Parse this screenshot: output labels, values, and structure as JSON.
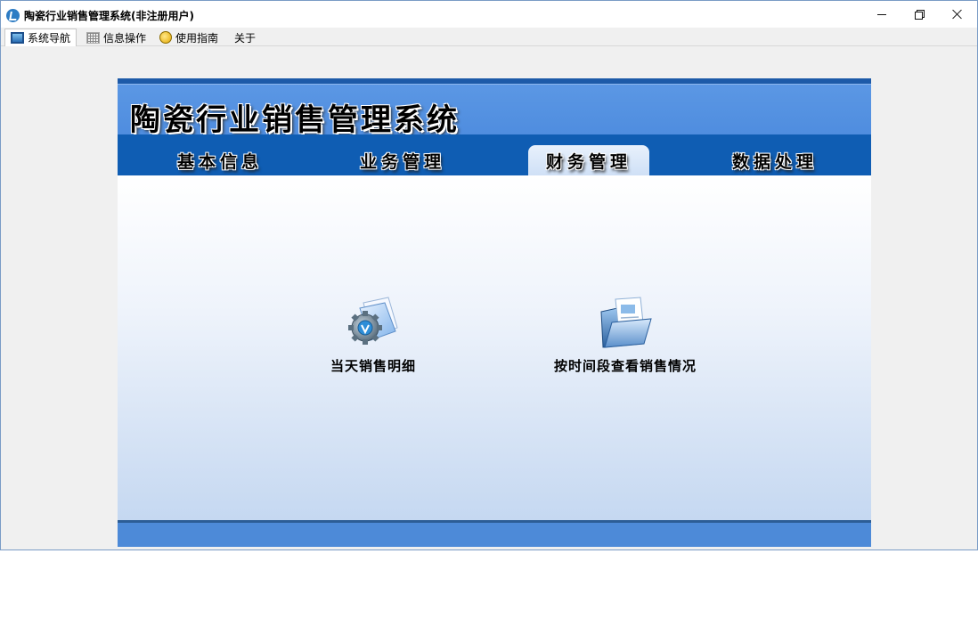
{
  "window": {
    "title": "陶瓷行业销售管理系统(非注册用户)",
    "controls": [
      "minimize",
      "restore",
      "close"
    ]
  },
  "menubar": {
    "items": [
      {
        "label": "系统导航",
        "icon": "monitor-icon"
      },
      {
        "label": "信息操作",
        "icon": "grid-icon"
      },
      {
        "label": "使用指南",
        "icon": "guide-icon"
      },
      {
        "label": "关于",
        "icon": ""
      }
    ]
  },
  "banner": {
    "title": "陶瓷行业销售管理系统"
  },
  "nav": {
    "tabs": [
      {
        "label": "基本信息",
        "active": false
      },
      {
        "label": "业务管理",
        "active": false
      },
      {
        "label": "财务管理",
        "active": true
      },
      {
        "label": "数据处理",
        "active": false
      }
    ]
  },
  "actions": [
    {
      "label": "当天销售明细",
      "icon": "folder-gear-icon"
    },
    {
      "label": "按时间段查看销售情况",
      "icon": "open-folder-icon"
    }
  ],
  "colors": {
    "topline": "#1d5aa8",
    "banner": "#5b97e4",
    "navbar": "#0f5db3",
    "footer": "#4d8ad8"
  }
}
